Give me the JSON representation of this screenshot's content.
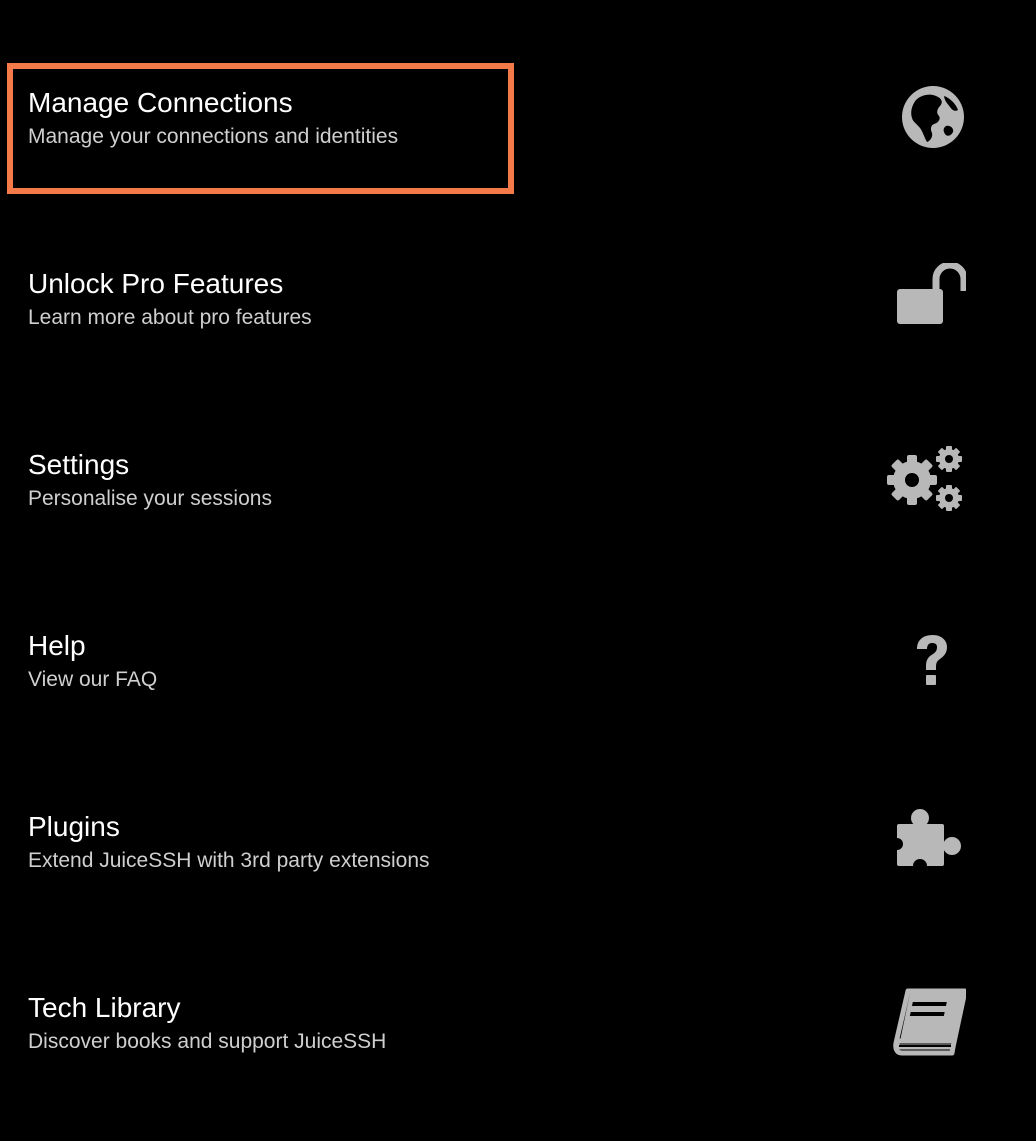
{
  "menu": {
    "items": [
      {
        "title": "Manage Connections",
        "subtitle": "Manage your connections and identities",
        "icon": "globe-icon"
      },
      {
        "title": "Unlock Pro Features",
        "subtitle": "Learn more about pro features",
        "icon": "unlock-icon"
      },
      {
        "title": "Settings",
        "subtitle": "Personalise your sessions",
        "icon": "gears-icon"
      },
      {
        "title": "Help",
        "subtitle": "View our FAQ",
        "icon": "question-icon"
      },
      {
        "title": "Plugins",
        "subtitle": "Extend JuiceSSH with 3rd party extensions",
        "icon": "puzzle-icon"
      },
      {
        "title": "Tech Library",
        "subtitle": "Discover books and support JuiceSSH",
        "icon": "book-icon"
      }
    ]
  },
  "colors": {
    "background": "#000000",
    "title": "#ffffff",
    "subtitle": "#cfcfcf",
    "icon": "#b8b8b8",
    "highlight": "#f57a4a"
  }
}
